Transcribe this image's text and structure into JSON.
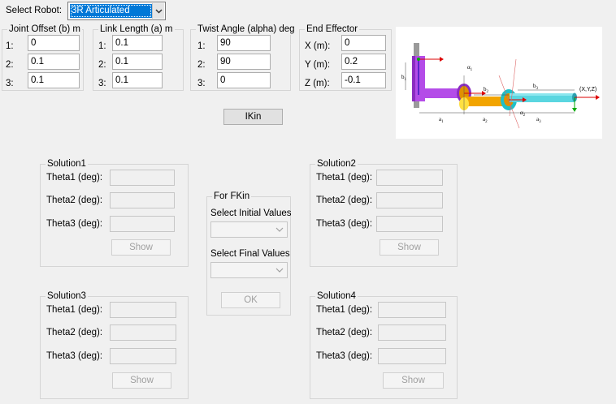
{
  "header": {
    "select_robot_label": "Select Robot:",
    "robot_selected": "3R Articulated"
  },
  "joint_offset": {
    "title": "Joint Offset (b) m",
    "rows": [
      {
        "label": "1:",
        "value": "0"
      },
      {
        "label": "2:",
        "value": "0.1"
      },
      {
        "label": "3:",
        "value": "0.1"
      }
    ]
  },
  "link_length": {
    "title": "Link Length (a) m",
    "rows": [
      {
        "label": "1:",
        "value": "0.1"
      },
      {
        "label": "2:",
        "value": "0.1"
      },
      {
        "label": "3:",
        "value": "0.1"
      }
    ]
  },
  "twist_angle": {
    "title": "Twist Angle (alpha) deg",
    "rows": [
      {
        "label": "1:",
        "value": "90"
      },
      {
        "label": "2:",
        "value": "90"
      },
      {
        "label": "3:",
        "value": "0"
      }
    ]
  },
  "end_effector": {
    "title": "End Effector",
    "rows": [
      {
        "label": "X (m):",
        "value": "0"
      },
      {
        "label": "Y (m):",
        "value": "0.2"
      },
      {
        "label": "Z (m):",
        "value": "-0.1"
      }
    ]
  },
  "diagram": {
    "b1": "b",
    "b1_sub": "1",
    "a1": "a",
    "a1_sub": "1",
    "a2": "a",
    "a2_sub": "2",
    "a3": "a",
    "a3_sub": "3",
    "b2": "b",
    "b2_sub": "2",
    "b3": "b",
    "b3_sub": "3",
    "alpha1": "α",
    "alpha1_sub": "1",
    "alpha2": "α",
    "alpha2_sub": "2",
    "xyz": "(X,Y,Z)"
  },
  "ikin_button": "IKin",
  "solutions": [
    {
      "title": "Solution1",
      "theta1": "Theta1 (deg):",
      "theta2": "Theta2 (deg):",
      "theta3": "Theta3 (deg):",
      "show": "Show"
    },
    {
      "title": "Solution2",
      "theta1": "Theta1 (deg):",
      "theta2": "Theta2 (deg):",
      "theta3": "Theta3 (deg):",
      "show": "Show"
    },
    {
      "title": "Solution3",
      "theta1": "Theta1 (deg):",
      "theta2": "Theta2 (deg):",
      "theta3": "Theta3 (deg):",
      "show": "Show"
    },
    {
      "title": "Solution4",
      "theta1": "Theta1 (deg):",
      "theta2": "Theta2 (deg):",
      "theta3": "Theta3 (deg):",
      "show": "Show"
    }
  ],
  "fkin": {
    "title": "For FKin",
    "initial_label": "Select Initial Values",
    "final_label": "Select Final Values",
    "ok": "OK"
  }
}
